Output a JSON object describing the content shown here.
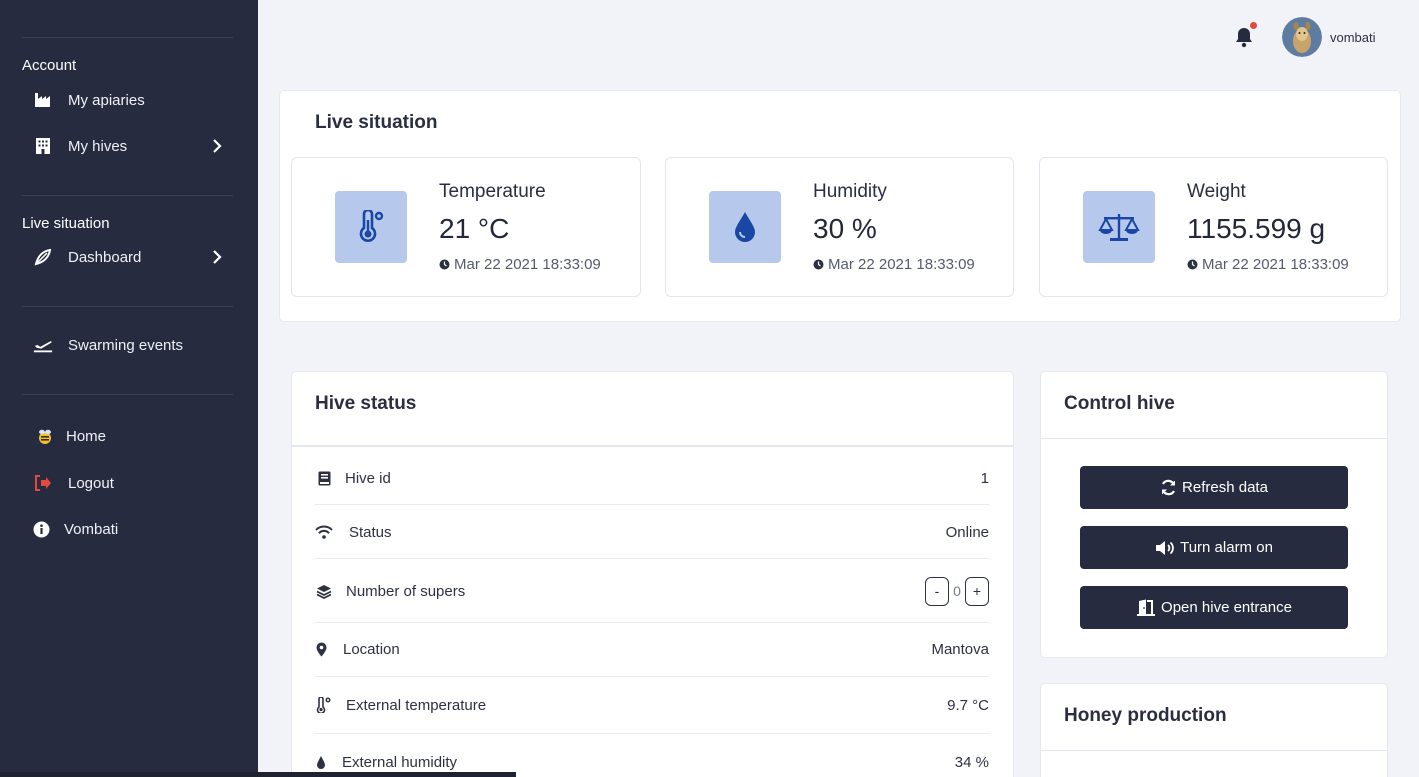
{
  "sidebar": {
    "sections": [
      {
        "title": "Account"
      },
      {
        "title": "Live situation"
      }
    ],
    "items": [
      {
        "label": "My apiaries",
        "icon": "industry-icon"
      },
      {
        "label": "My hives",
        "icon": "building-icon"
      },
      {
        "label": "Dashboard",
        "icon": "feather-icon"
      },
      {
        "label": "Swarming events",
        "icon": "plane-departure-icon"
      },
      {
        "label": "Home",
        "icon": "bee-logo-icon"
      },
      {
        "label": "Logout",
        "icon": "logout-icon"
      },
      {
        "label": "Vombati",
        "icon": "info-icon"
      }
    ]
  },
  "topbar": {
    "username": "vombati"
  },
  "live": {
    "title": "Live situation",
    "stats": [
      {
        "name": "Temperature",
        "value": "21 °C",
        "time": "Mar 22 2021 18:33:09",
        "icon": "thermometer-icon"
      },
      {
        "name": "Humidity",
        "value": "30 %",
        "time": "Mar 22 2021 18:33:09",
        "icon": "droplet-icon"
      },
      {
        "name": "Weight",
        "value": "1155.599 g",
        "time": "Mar 22 2021 18:33:09",
        "icon": "balance-scale-icon"
      }
    ]
  },
  "hive_status": {
    "title": "Hive status",
    "rows": [
      {
        "label": "Hive id",
        "value": "1",
        "icon": "book-icon"
      },
      {
        "label": "Status",
        "value": "Online",
        "icon": "wifi-icon"
      },
      {
        "label": "Number of supers",
        "value": "0",
        "icon": "layers-icon",
        "minus": "-",
        "plus": "+"
      },
      {
        "label": "Location",
        "value": "Mantova",
        "icon": "map-marker-icon"
      },
      {
        "label": "External temperature",
        "value": "9.7 °C",
        "icon": "thermometer-icon"
      },
      {
        "label": "External humidity",
        "value": "34 %",
        "icon": "droplet-icon"
      }
    ]
  },
  "control": {
    "title": "Control hive",
    "buttons": [
      {
        "label": "Refresh data",
        "icon": "refresh-icon"
      },
      {
        "label": "Turn alarm on",
        "icon": "volume-icon"
      },
      {
        "label": "Open hive entrance",
        "icon": "door-open-icon"
      }
    ]
  },
  "honey": {
    "title": "Honey production"
  },
  "colors": {
    "sidebar_bg": "#272b3f",
    "page_bg": "#f1f3f8",
    "icon_tile": "#b6c9ec",
    "icon_blue": "#1a46a6",
    "button_bg": "#272b3f",
    "notification_dot": "#e5483d"
  }
}
